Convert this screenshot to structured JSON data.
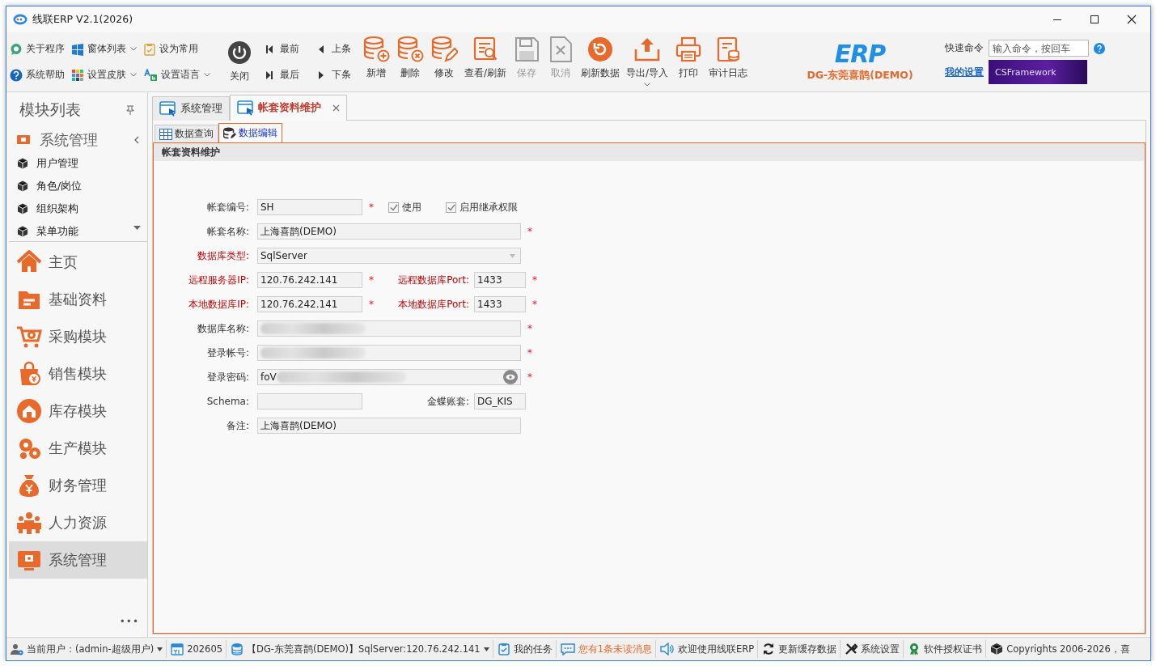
{
  "window": {
    "title": "线联ERP V2.1(2026)"
  },
  "ribbon": {
    "quick": [
      {
        "label": "关于程序",
        "dropdown": false
      },
      {
        "label": "窗体列表",
        "dropdown": true
      },
      {
        "label": "设为常用",
        "dropdown": false
      },
      {
        "label": "系统帮助",
        "dropdown": false
      },
      {
        "label": "设置皮肤",
        "dropdown": true
      },
      {
        "label": "设置语言",
        "dropdown": true
      }
    ],
    "close": {
      "label": "关闭"
    },
    "nav": [
      {
        "label": "最前"
      },
      {
        "label": "上条"
      },
      {
        "label": "最后"
      },
      {
        "label": "下条"
      }
    ],
    "actions": [
      {
        "label": "新增",
        "disabled": false,
        "dropdown": false
      },
      {
        "label": "删除",
        "disabled": false,
        "dropdown": false
      },
      {
        "label": "修改",
        "disabled": false,
        "dropdown": false
      },
      {
        "label": "查看/刷新",
        "disabled": false,
        "dropdown": false
      },
      {
        "label": "保存",
        "disabled": true,
        "dropdown": false
      },
      {
        "label": "取消",
        "disabled": true,
        "dropdown": false
      },
      {
        "label": "刷新数据",
        "disabled": false,
        "dropdown": false
      },
      {
        "label": "导出/导入",
        "disabled": false,
        "dropdown": true
      },
      {
        "label": "打印",
        "disabled": false,
        "dropdown": false
      },
      {
        "label": "审计日志",
        "disabled": false,
        "dropdown": false
      }
    ],
    "brand": {
      "logo": "ERP",
      "company": "DG-东莞喜鹊(DEMO)"
    },
    "quick_command": {
      "label": "快速命令",
      "placeholder": "输入命令，按回车"
    },
    "settings_link": "我的设置",
    "banner": "CSFramework"
  },
  "sidebar": {
    "title": "模块列表",
    "group": {
      "label": "系统管理",
      "expanded": true,
      "items": [
        {
          "label": "用户管理"
        },
        {
          "label": "角色/岗位"
        },
        {
          "label": "组织架构"
        },
        {
          "label": "菜单功能"
        }
      ]
    },
    "modules": [
      {
        "label": "主页",
        "selected": false
      },
      {
        "label": "基础资料",
        "selected": false
      },
      {
        "label": "采购模块",
        "selected": false
      },
      {
        "label": "销售模块",
        "selected": false
      },
      {
        "label": "库存模块",
        "selected": false
      },
      {
        "label": "生产模块",
        "selected": false
      },
      {
        "label": "财务管理",
        "selected": false
      },
      {
        "label": "人力资源",
        "selected": false
      },
      {
        "label": "系统管理",
        "selected": true
      }
    ],
    "more": "•••"
  },
  "tabs": [
    {
      "label": "系统管理",
      "selected": false,
      "closable": false
    },
    {
      "label": "帐套资料维护",
      "selected": true,
      "closable": true
    }
  ],
  "subtabs": [
    {
      "label": "数据查询",
      "selected": false
    },
    {
      "label": "数据编辑",
      "selected": true
    }
  ],
  "form": {
    "title": "帐套资料维护",
    "rows": [
      [
        {
          "kind": "text",
          "label": "帐套编号:",
          "value": "SH",
          "warn": false,
          "asterisk": "*"
        },
        {
          "kind": "check",
          "label": "使用",
          "checked": true
        },
        {
          "kind": "check",
          "label": "启用继承权限",
          "checked": true
        }
      ],
      [
        {
          "kind": "text",
          "label": "帐套名称:",
          "value": "上海喜鹊(DEMO)",
          "warn": false,
          "asterisk": "*"
        }
      ],
      [
        {
          "kind": "combo",
          "label": "数据库类型:",
          "value": "SqlServer",
          "warn": true
        }
      ],
      [
        {
          "kind": "text",
          "label": "远程服务器IP:",
          "value": "120.76.242.141",
          "warn": true,
          "asterisk": "*"
        },
        {
          "kind": "text",
          "label": "远程数据库Port:",
          "value": "1433",
          "warn": true,
          "asterisk": "*"
        }
      ],
      [
        {
          "kind": "text",
          "label": "本地数据库IP:",
          "value": "120.76.242.141",
          "warn": true,
          "asterisk": "*"
        },
        {
          "kind": "text",
          "label": "本地数据库Port:",
          "value": "1433",
          "warn": true,
          "asterisk": "*"
        }
      ],
      [
        {
          "kind": "text",
          "label": "数据库名称:",
          "warn": false,
          "asterisk": "*",
          "redacted": true
        }
      ],
      [
        {
          "kind": "text",
          "label": "登录帐号:",
          "warn": false,
          "asterisk": "*",
          "redacted": true
        }
      ],
      [
        {
          "kind": "password",
          "label": "登录密码:",
          "value": "foV",
          "warn": false,
          "asterisk": "*",
          "redacted": true
        }
      ],
      [
        {
          "kind": "text",
          "label": "Schema:",
          "warn": false
        },
        {
          "kind": "text",
          "label": "金蝶账套:",
          "value": "DG_KIS",
          "warn": false
        }
      ],
      [
        {
          "kind": "text",
          "label": "备注:",
          "value": "上海喜鹊(DEMO)",
          "warn": false
        }
      ]
    ]
  },
  "status_bar": [
    {
      "label": "当前用户：(admin-超级用户)",
      "dropdown": true,
      "highlight": false
    },
    {
      "label": "202605",
      "dropdown": false,
      "highlight": false
    },
    {
      "label": "【DG-东莞喜鹊(DEMO)】SqlServer:120.76.242.141",
      "dropdown": true,
      "highlight": false
    },
    {
      "label": "我的任务",
      "dropdown": false,
      "highlight": false
    },
    {
      "label": "您有1条未读消息",
      "dropdown": false,
      "highlight": true
    },
    {
      "label": "欢迎使用线联ERP",
      "dropdown": false,
      "highlight": false
    },
    {
      "label": "更新缓存数据",
      "dropdown": false,
      "highlight": false
    },
    {
      "label": "系统设置",
      "dropdown": false,
      "highlight": false
    },
    {
      "label": "软件授权证书",
      "dropdown": false,
      "highlight": false
    },
    {
      "label": "Copyrights 2006-2026，喜",
      "dropdown": false,
      "highlight": false
    }
  ]
}
